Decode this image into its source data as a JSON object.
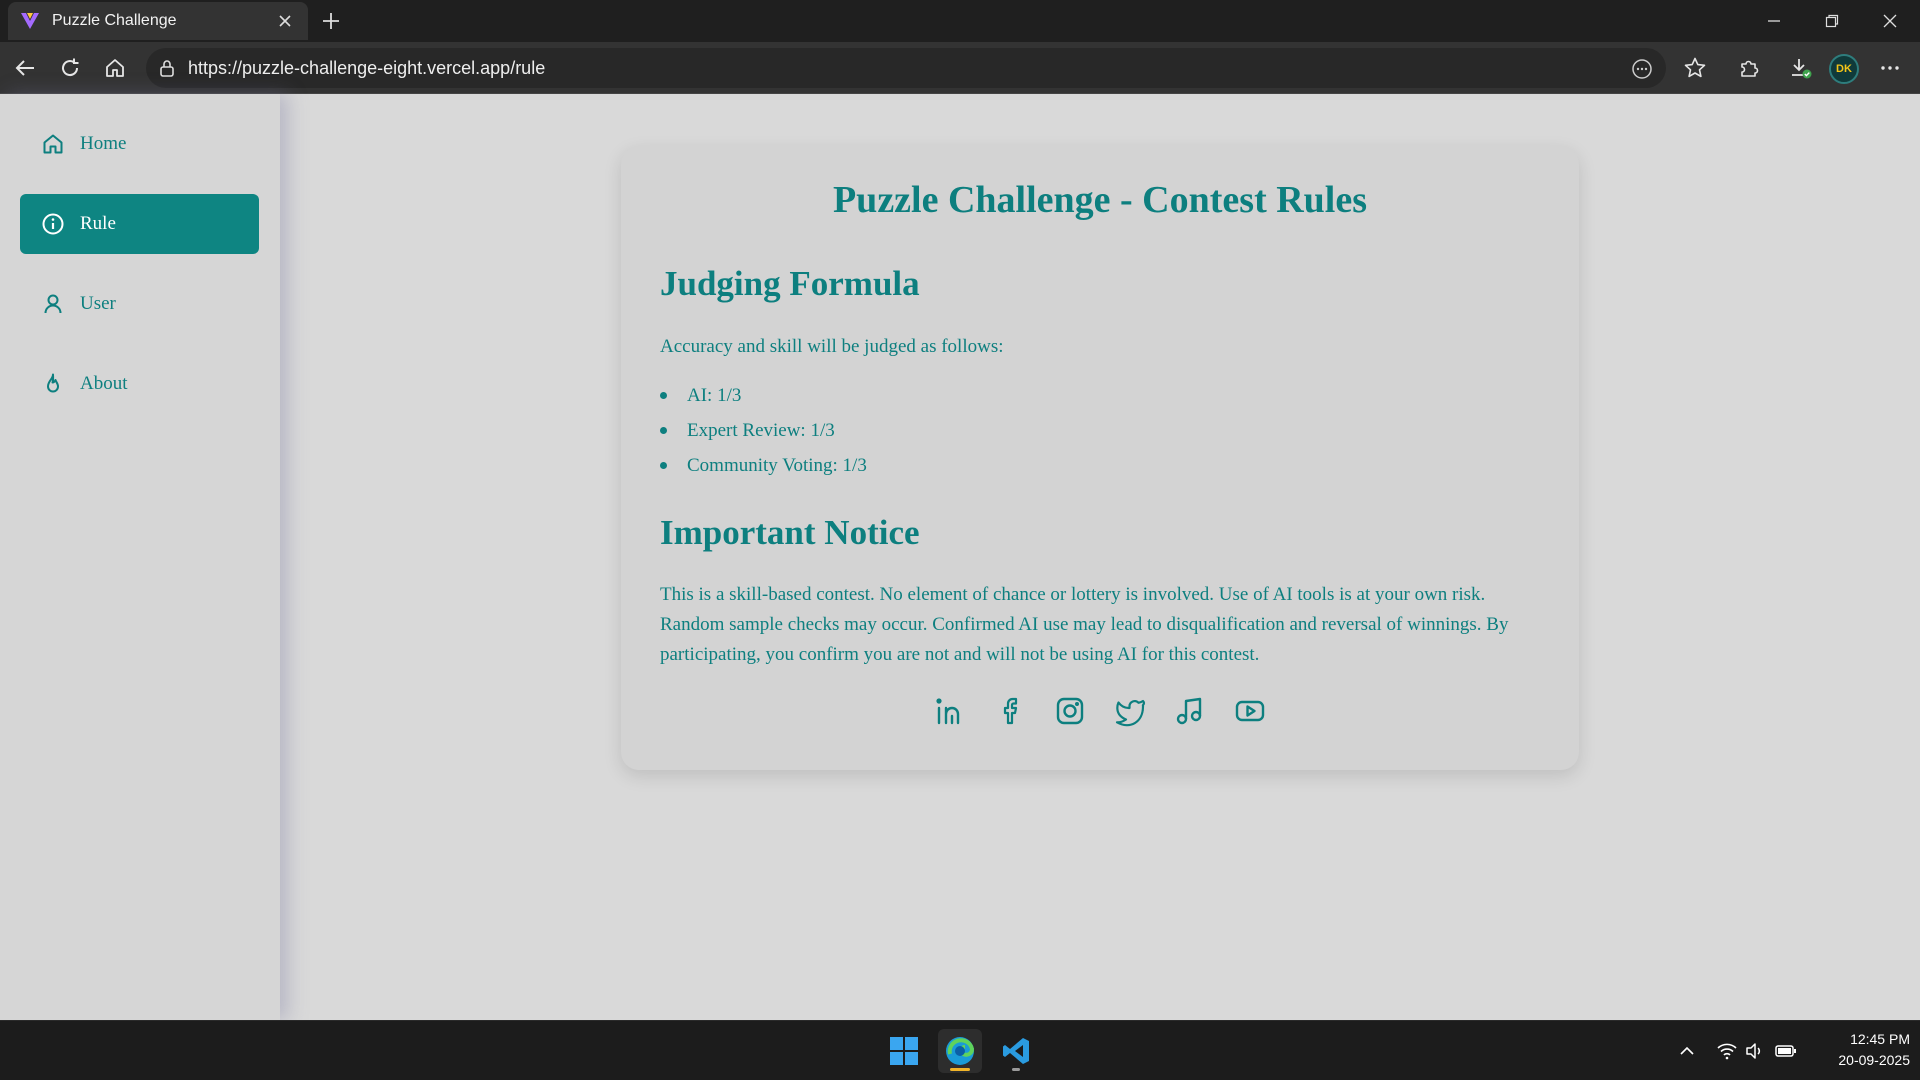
{
  "browser": {
    "tab_title": "Puzzle Challenge",
    "url": "https://puzzle-challenge-eight.vercel.app/rule",
    "profile_initials": "DK"
  },
  "sidebar": {
    "items": [
      {
        "label": "Home",
        "icon": "home-icon",
        "active": false
      },
      {
        "label": "Rule",
        "icon": "info-icon",
        "active": true
      },
      {
        "label": "User",
        "icon": "user-icon",
        "active": false
      },
      {
        "label": "About",
        "icon": "flame-icon",
        "active": false
      }
    ]
  },
  "content": {
    "title": "Puzzle Challenge - Contest Rules",
    "judging": {
      "heading": "Judging Formula",
      "intro": "Accuracy and skill will be judged as follows:",
      "items": [
        "AI: 1/3",
        "Expert Review: 1/3",
        "Community Voting: 1/3"
      ]
    },
    "notice": {
      "heading": "Important Notice",
      "text": "This is a skill-based contest. No element of chance or lottery is involved. Use of AI tools is at your own risk. Random sample checks may occur. Confirmed AI use may lead to disqualification and reversal of winnings. By participating, you confirm you are not and will not be using AI for this contest."
    },
    "socials": [
      "linkedin-icon",
      "facebook-icon",
      "instagram-icon",
      "twitter-icon",
      "music-icon",
      "youtube-icon"
    ]
  },
  "taskbar": {
    "time": "12:45 PM",
    "date": "20-09-2025"
  },
  "colors": {
    "accent": "#0e8582",
    "text_teal": "#0d7f7f",
    "page_bg": "#d9d9d9"
  }
}
